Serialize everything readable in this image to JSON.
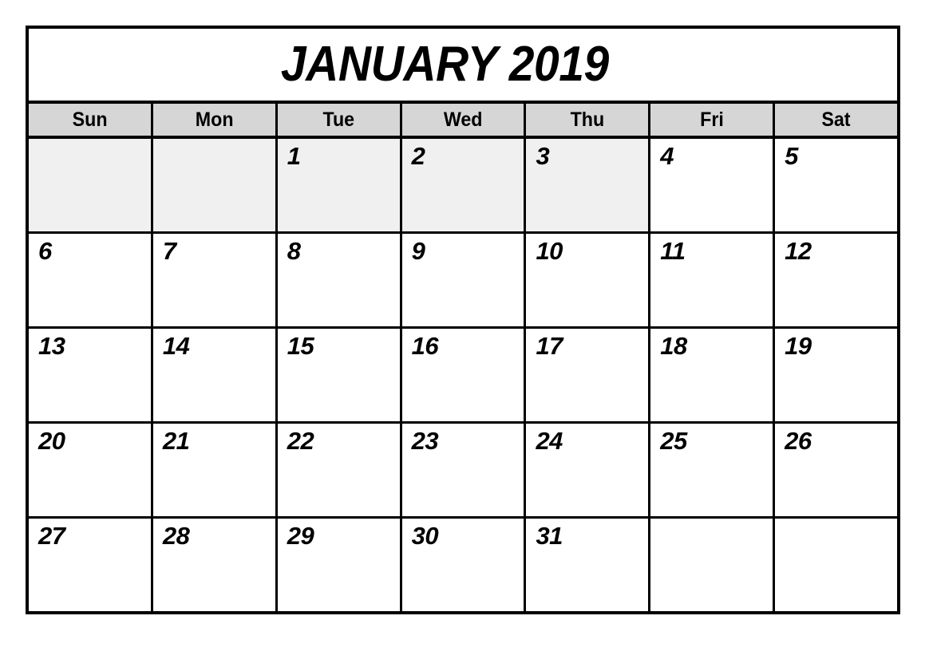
{
  "calendar": {
    "title": "JANUARY 2019",
    "month": "JANUARY",
    "year": "2019",
    "weekday_headers": [
      {
        "label": "Sun"
      },
      {
        "label": "Mon"
      },
      {
        "label": "Tue"
      },
      {
        "label": "Wed"
      },
      {
        "label": "Thu"
      },
      {
        "label": "Fri"
      },
      {
        "label": "Sat"
      }
    ],
    "colors": {
      "border": "#000000",
      "header_background": "#d6d6d6",
      "shaded_cell_background": "#f0f0f0",
      "cell_background": "#ffffff",
      "text": "#000000"
    },
    "weeks": [
      {
        "days": [
          {
            "number": "",
            "shaded": true
          },
          {
            "number": "",
            "shaded": true
          },
          {
            "number": "1",
            "shaded": true
          },
          {
            "number": "2",
            "shaded": true
          },
          {
            "number": "3",
            "shaded": true
          },
          {
            "number": "4",
            "shaded": false
          },
          {
            "number": "5",
            "shaded": false
          }
        ]
      },
      {
        "days": [
          {
            "number": "6",
            "shaded": false
          },
          {
            "number": "7",
            "shaded": false
          },
          {
            "number": "8",
            "shaded": false
          },
          {
            "number": "9",
            "shaded": false
          },
          {
            "number": "10",
            "shaded": false
          },
          {
            "number": "11",
            "shaded": false
          },
          {
            "number": "12",
            "shaded": false
          }
        ]
      },
      {
        "days": [
          {
            "number": "13",
            "shaded": false
          },
          {
            "number": "14",
            "shaded": false
          },
          {
            "number": "15",
            "shaded": false
          },
          {
            "number": "16",
            "shaded": false
          },
          {
            "number": "17",
            "shaded": false
          },
          {
            "number": "18",
            "shaded": false
          },
          {
            "number": "19",
            "shaded": false
          }
        ]
      },
      {
        "days": [
          {
            "number": "20",
            "shaded": false
          },
          {
            "number": "21",
            "shaded": false
          },
          {
            "number": "22",
            "shaded": false
          },
          {
            "number": "23",
            "shaded": false
          },
          {
            "number": "24",
            "shaded": false
          },
          {
            "number": "25",
            "shaded": false
          },
          {
            "number": "26",
            "shaded": false
          }
        ]
      },
      {
        "days": [
          {
            "number": "27",
            "shaded": false
          },
          {
            "number": "28",
            "shaded": false
          },
          {
            "number": "29",
            "shaded": false
          },
          {
            "number": "30",
            "shaded": false
          },
          {
            "number": "31",
            "shaded": false
          },
          {
            "number": "",
            "shaded": false
          },
          {
            "number": "",
            "shaded": false
          }
        ]
      }
    ]
  }
}
